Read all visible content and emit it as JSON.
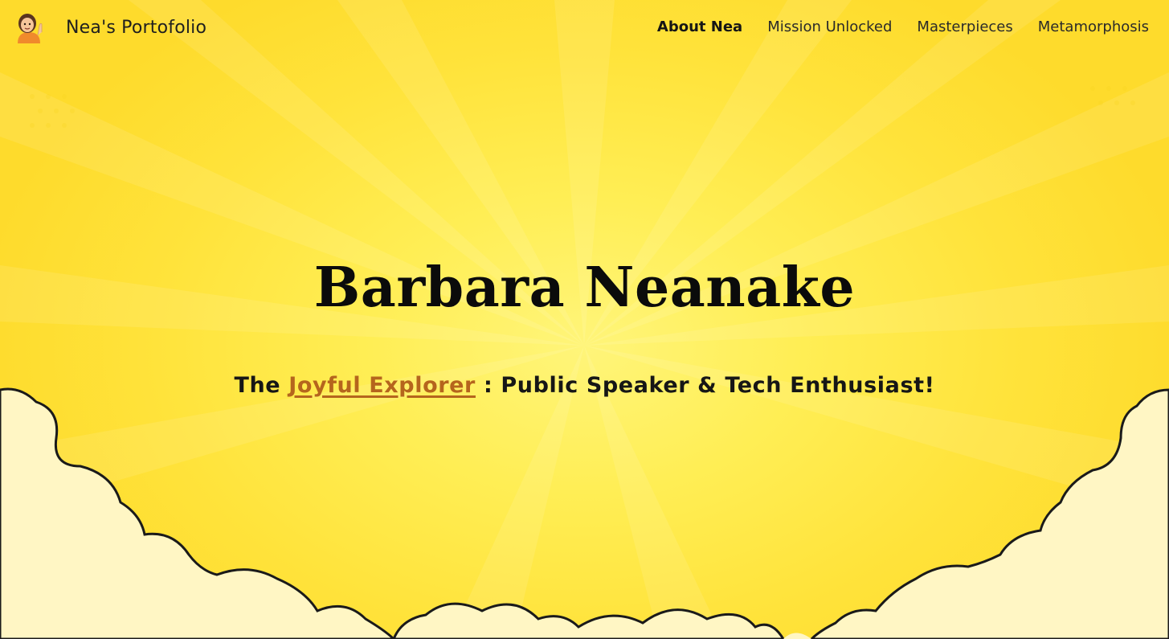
{
  "header": {
    "brand_name": "Nea's Portofolio",
    "avatar_icon": "woman-tipping-hand-icon"
  },
  "nav": {
    "items": [
      {
        "label": "About Nea",
        "active": true
      },
      {
        "label": "Mission Unlocked",
        "active": false
      },
      {
        "label": "Masterpieces",
        "active": false
      },
      {
        "label": "Metamorphosis",
        "active": false
      }
    ]
  },
  "hero": {
    "title": "Barbara Neanake",
    "tagline_prefix": "The ",
    "tagline_highlight": "Joyful Explorer",
    "tagline_suffix": " : Public Speaker & Tech Enthusiast!"
  },
  "colors": {
    "background": "#ffe23a",
    "highlight": "#b5651d",
    "cloud_fill": "#fff6c4",
    "cloud_back": "#f7b77a"
  }
}
